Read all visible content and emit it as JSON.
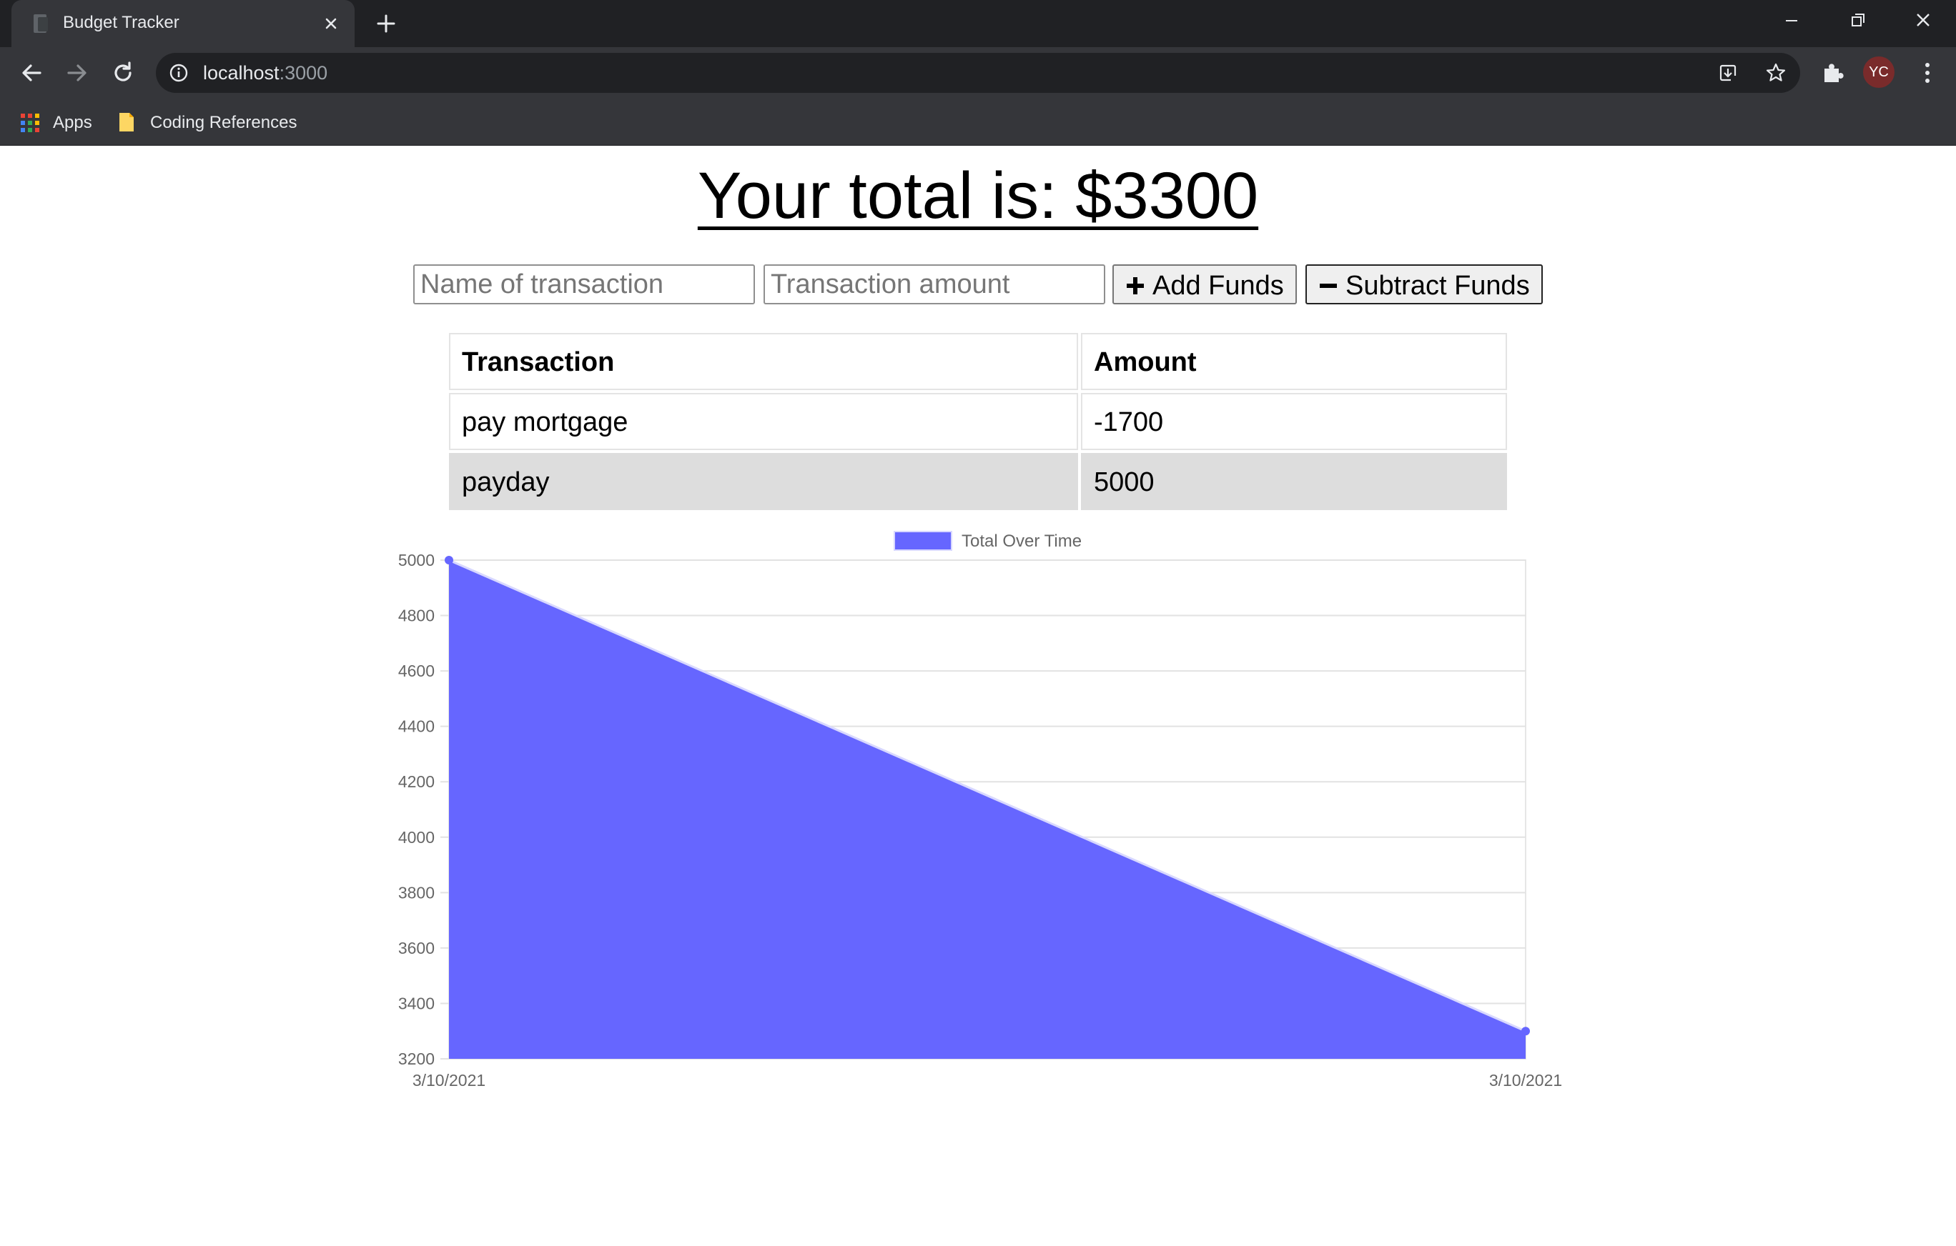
{
  "browser": {
    "tab_title": "Budget Tracker",
    "url_host": "localhost",
    "url_port": ":3000",
    "profile_initials": "YC",
    "bookmarks": [
      {
        "label": "Apps"
      },
      {
        "label": "Coding References"
      }
    ]
  },
  "page": {
    "total_text": "Your total is: $3300",
    "name_placeholder": "Name of transaction",
    "amount_placeholder": "Transaction amount",
    "add_label": "Add Funds",
    "subtract_label": "Subtract Funds",
    "table": {
      "headers": [
        "Transaction",
        "Amount"
      ],
      "rows": [
        {
          "name": "pay mortgage",
          "amount": "-1700"
        },
        {
          "name": "payday",
          "amount": "5000"
        }
      ]
    }
  },
  "chart_data": {
    "type": "area",
    "x": [
      "3/10/2021",
      "3/10/2021"
    ],
    "series": [
      {
        "name": "Total Over Time",
        "values": [
          5000,
          3300
        ],
        "color": "#6666ff"
      }
    ],
    "ylim": [
      3200,
      5000
    ],
    "yticks": [
      5000,
      4800,
      4600,
      4400,
      4200,
      4000,
      3800,
      3600,
      3400,
      3200
    ],
    "grid": true,
    "legend": "top-center"
  }
}
